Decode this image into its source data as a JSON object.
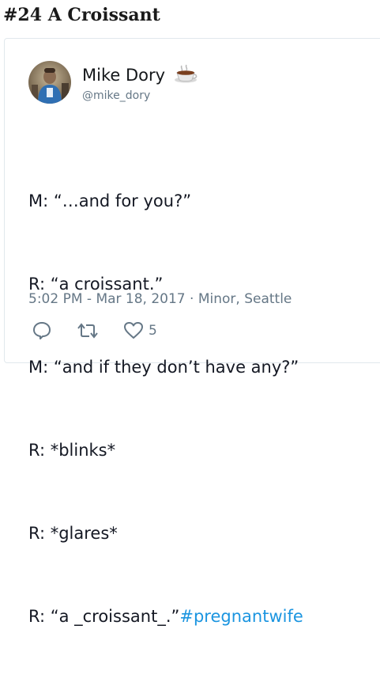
{
  "heading": "#24 A Croissant",
  "tweet": {
    "author_name": "Mike Dory",
    "author_emoji": "coffee-cup-icon",
    "handle": "@mike_dory",
    "lines": [
      "M: “…and for you?”",
      "R: “a croissant.”",
      "M: “and if they don’t have any?”",
      "R: *blinks*",
      "R: *glares*"
    ],
    "last_line_text": "R: “a _croissant_.”",
    "hashtag": "#pregnantwife",
    "meta": "5:02 PM - Mar 18, 2017 · Minor, Seattle",
    "like_count": "5"
  },
  "colors": {
    "link": "#1b95e0",
    "muted": "#657786",
    "border": "#e1e8ed"
  }
}
